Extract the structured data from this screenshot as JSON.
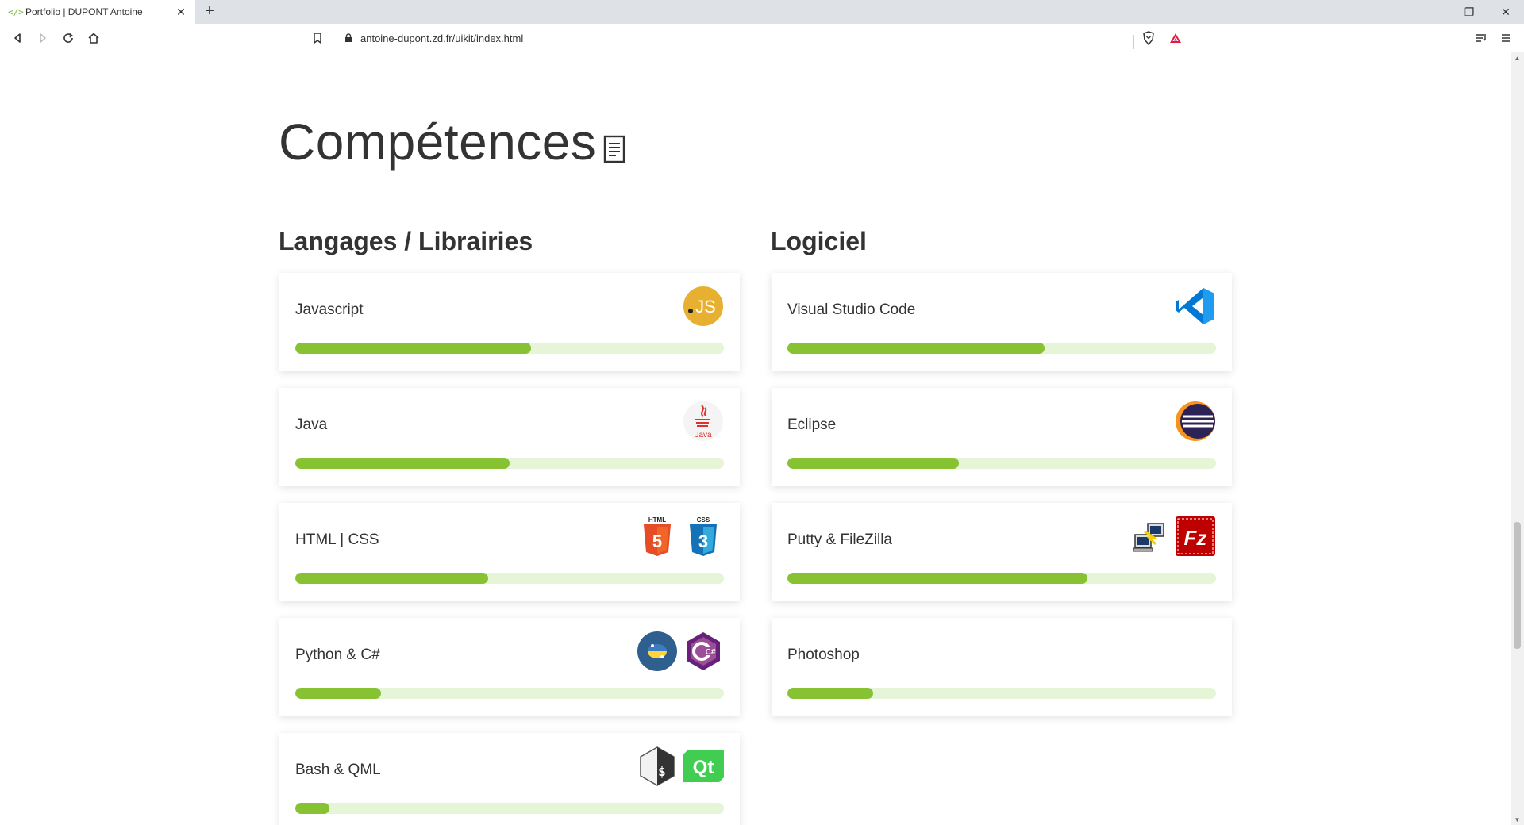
{
  "browser": {
    "tab_favicon": "</>",
    "tab_title": "Portfolio | DUPONT Antoine",
    "tab_close": "✕",
    "new_tab": "+",
    "url": "antoine-dupont.zd.fr/uikit/index.html",
    "window_controls": {
      "minimize": "—",
      "restore": "❐",
      "close": "✕"
    }
  },
  "section": {
    "title": "Compétences"
  },
  "columns": {
    "left_title": "Langages / Librairies",
    "right_title": "Logiciel"
  },
  "skills_left": [
    {
      "label": "Javascript",
      "level": 0.55,
      "icons": [
        "javascript-icon"
      ]
    },
    {
      "label": "Java",
      "level": 0.5,
      "icons": [
        "java-icon"
      ]
    },
    {
      "label": "HTML | CSS",
      "level": 0.45,
      "icons": [
        "html5-icon",
        "css3-icon"
      ]
    },
    {
      "label": "Python & C#",
      "level": 0.2,
      "icons": [
        "python-icon",
        "csharp-icon"
      ]
    },
    {
      "label": "Bash & QML",
      "level": 0.08,
      "icons": [
        "bash-icon",
        "qt-icon"
      ]
    }
  ],
  "skills_right": [
    {
      "label": "Visual Studio Code",
      "level": 0.6,
      "icons": [
        "vscode-icon"
      ]
    },
    {
      "label": "Eclipse",
      "level": 0.4,
      "icons": [
        "eclipse-icon"
      ]
    },
    {
      "label": "Putty & FileZilla",
      "level": 0.7,
      "icons": [
        "putty-icon",
        "filezilla-icon"
      ]
    },
    {
      "label": "Photoshop",
      "level": 0.2,
      "icons": []
    }
  ],
  "icon_text": {
    "js": "JS",
    "java": "Java",
    "html": "HTML",
    "html_num": "5",
    "css": "CSS",
    "css_num": "3",
    "csharp": "C#",
    "qt": "Qt",
    "bash": "$",
    "fz": "Fz"
  },
  "colors": {
    "progress_fill": "#86c232",
    "progress_track": "#e6f4d7"
  }
}
